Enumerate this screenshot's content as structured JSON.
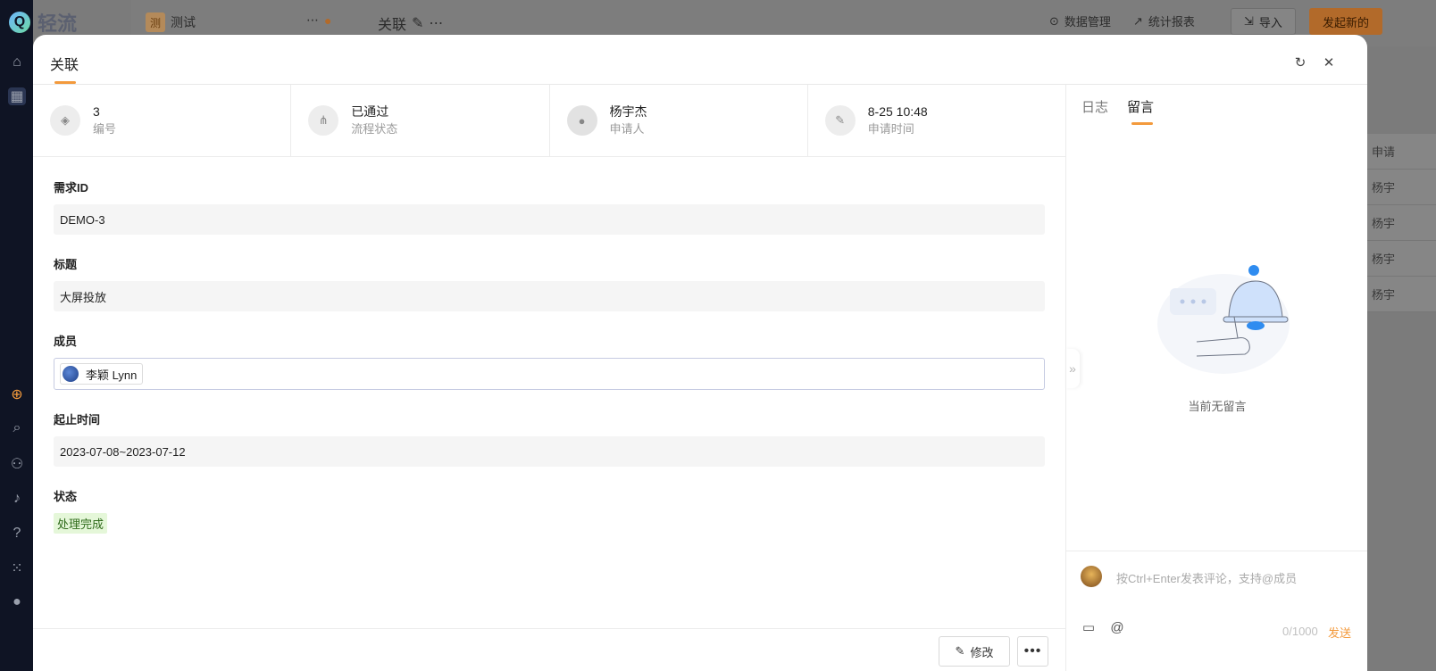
{
  "background_app": {
    "logo_text": "轻流",
    "app_tag": "测",
    "app_name": "测试",
    "tab_name": "关联",
    "data_manage": "数据管理",
    "stats_report": "统计报表",
    "import_label": "导入",
    "start_new_label": "发起新的",
    "right_column": [
      "申请",
      "杨宇",
      "杨宇",
      "杨宇",
      "杨宇"
    ]
  },
  "modal": {
    "title": "关联",
    "info": [
      {
        "value": "3",
        "label": "编号",
        "icon": "badge-icon"
      },
      {
        "value": "已通过",
        "label": "流程状态",
        "icon": "flow-icon"
      },
      {
        "value": "杨宇杰",
        "label": "申请人",
        "icon": "avatar-icon"
      },
      {
        "value": "8-25 10:48",
        "label": "申请时间",
        "icon": "edit-icon"
      }
    ],
    "fields": {
      "req_id": {
        "label": "需求ID",
        "value": "DEMO-3"
      },
      "title": {
        "label": "标题",
        "value": "大屏投放"
      },
      "member": {
        "label": "成员",
        "value": "李颖 Lynn"
      },
      "period": {
        "label": "起止时间",
        "value": "2023-07-08~2023-07-12"
      },
      "status": {
        "label": "状态",
        "value": "处理完成"
      }
    },
    "edit_label": "修改",
    "more_label": "•••"
  },
  "panel": {
    "tabs": [
      "日志",
      "留言"
    ],
    "active_tab": 1,
    "empty_text": "当前无留言",
    "comment_placeholder": "按Ctrl+Enter发表评论，支持@成员",
    "char_count": "0/1000",
    "send_label": "发送"
  },
  "colors": {
    "accent": "#f39a3c",
    "status_bg": "#e5f7d9"
  }
}
